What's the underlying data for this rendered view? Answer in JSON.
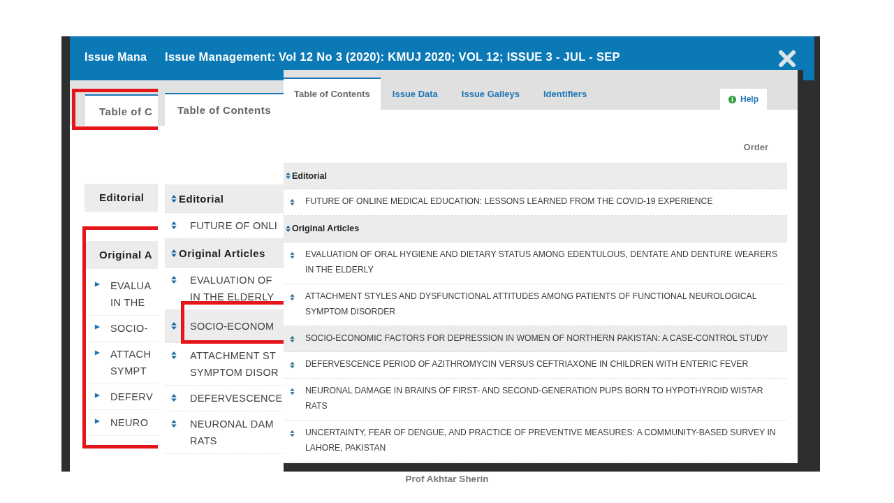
{
  "title_bar": {
    "back_title": "Issue Mana",
    "title": "Issue Management: Vol 12 No 3 (2020): KMUJ 2020; VOL 12; ISSUE 3 - JUL - SEP"
  },
  "back_layer": {
    "tab": "Table of C",
    "sections": [
      {
        "name": "Editorial"
      },
      {
        "name": "Original A",
        "rows": [
          {
            "lines": [
              "EVALUA",
              "IN THE"
            ]
          },
          {
            "lines": [
              "SOCIO-"
            ]
          },
          {
            "lines": [
              "ATTACH",
              "SYMPT"
            ]
          },
          {
            "lines": [
              "DEFERV"
            ]
          },
          {
            "lines": [
              "NEURO"
            ]
          }
        ]
      }
    ]
  },
  "middle_layer": {
    "tab": "Table of Contents",
    "sections": [
      {
        "name": "Editorial",
        "rows": [
          {
            "lines": [
              "FUTURE OF ONLI"
            ],
            "highlighted": false
          }
        ]
      },
      {
        "name": "Original Articles",
        "rows": [
          {
            "lines": [
              "EVALUATION OF",
              "IN THE ELDERLY"
            ],
            "highlighted": false
          },
          {
            "lines": [
              "SOCIO-ECONOM"
            ],
            "highlighted": true
          },
          {
            "lines": [
              "ATTACHMENT ST",
              "SYMPTOM DISOR"
            ],
            "highlighted": false
          },
          {
            "lines": [
              "DEFERVESCENCE"
            ],
            "highlighted": false
          },
          {
            "lines": [
              "NEURONAL DAM",
              "RATS"
            ],
            "highlighted": false
          }
        ]
      }
    ]
  },
  "front_layer": {
    "tabs": [
      {
        "label": "Table of Contents",
        "selected": true
      },
      {
        "label": "Issue Data",
        "selected": false
      },
      {
        "label": "Issue Galleys",
        "selected": false
      },
      {
        "label": "Identifiers",
        "selected": false
      }
    ],
    "help": "Help",
    "order_label": "Order",
    "sections": [
      {
        "name": "Editorial",
        "rows": [
          {
            "lines": [
              "FUTURE OF ONLINE MEDICAL EDUCATION: LESSONS LEARNED FROM THE COVID-19 EXPERIENCE"
            ],
            "highlighted": false
          }
        ]
      },
      {
        "name": "Original Articles",
        "rows": [
          {
            "lines": [
              "EVALUATION OF ORAL HYGIENE AND DIETARY STATUS AMONG EDENTULOUS, DENTATE AND DENTURE WEARERS",
              "IN THE ELDERLY"
            ],
            "highlighted": false
          },
          {
            "lines": [
              "ATTACHMENT STYLES AND DYSFUNCTIONAL ATTITUDES AMONG PATIENTS OF FUNCTIONAL NEUROLOGICAL",
              "SYMPTOM DISORDER"
            ],
            "highlighted": false
          },
          {
            "lines": [
              "SOCIO-ECONOMIC FACTORS FOR DEPRESSION IN WOMEN OF NORTHERN PAKISTAN: A CASE-CONTROL STUDY"
            ],
            "highlighted": true
          },
          {
            "lines": [
              "DEFERVESCENCE PERIOD OF AZITHROMYCIN VERSUS CEFTRIAXONE IN CHILDREN WITH ENTERIC FEVER"
            ],
            "highlighted": false
          },
          {
            "lines": [
              "NEURONAL DAMAGE IN BRAINS OF FIRST- AND SECOND-GENERATION PUPS BORN TO HYPOTHYROID WISTAR",
              "RATS"
            ],
            "highlighted": false
          },
          {
            "lines": [
              "UNCERTAINTY, FEAR OF DENGUE, AND PRACTICE OF PREVENTIVE MEASURES: A COMMUNITY-BASED SURVEY IN",
              "LAHORE, PAKISTAN"
            ],
            "highlighted": false
          }
        ]
      }
    ]
  },
  "footer": "Prof Akhtar Sherin"
}
